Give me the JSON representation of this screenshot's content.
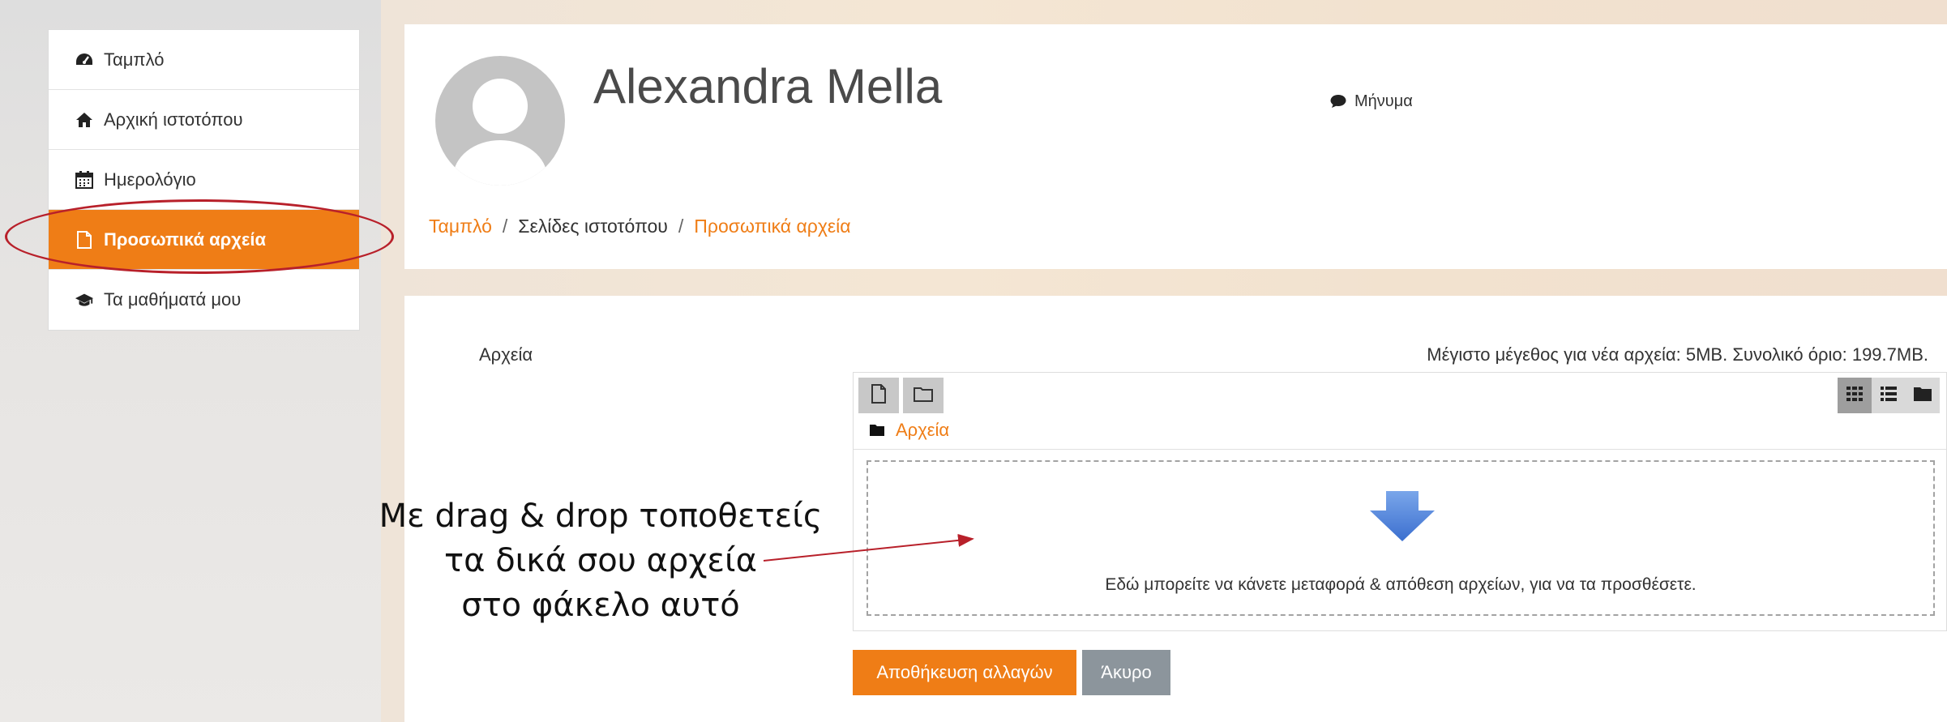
{
  "sidebar": {
    "items": [
      {
        "label": "Ταμπλό",
        "icon": "dashboard-icon"
      },
      {
        "label": "Αρχική ιστοτόπου",
        "icon": "home-icon"
      },
      {
        "label": "Ημερολόγιο",
        "icon": "calendar-icon"
      },
      {
        "label": "Προσωπικά αρχεία",
        "icon": "file-icon",
        "active": true
      },
      {
        "label": "Τα μαθήματά μου",
        "icon": "graduation-cap-icon"
      }
    ]
  },
  "header": {
    "user_name": "Alexandra Mella",
    "message_label": "Μήνυμα",
    "breadcrumb": [
      "Ταμπλό",
      "Σελίδες ιστοτόπου",
      "Προσωπικά αρχεία"
    ]
  },
  "main": {
    "files_label": "Αρχεία",
    "limits_text": "Μέγιστο μέγεθος για νέα αρχεία: 5MB. Συνολικό όριο: 199.7MB.",
    "filemanager": {
      "path_label": "Αρχεία",
      "toolbar": [
        "add-file-icon",
        "create-folder-icon"
      ],
      "views": [
        "grid-view-icon",
        "list-view-icon",
        "tree-view-icon"
      ],
      "dropzone_text": "Εδώ μπορείτε να κάνετε μεταφορά & απόθεση αρχείων, για να τα προσθέσετε."
    },
    "save_label": "Αποθήκευση αλλαγών",
    "cancel_label": "Άκυρο"
  },
  "annotation": {
    "lines": [
      "Με drag & drop τοποθετείς",
      "τα δικά σου αρχεία",
      "στο φάκελο αυτό"
    ]
  },
  "colors": {
    "accent": "#ef7d16",
    "highlight": "#b8202a",
    "cancel": "#8c959c",
    "drop_arrow": "#4a7fd6"
  }
}
